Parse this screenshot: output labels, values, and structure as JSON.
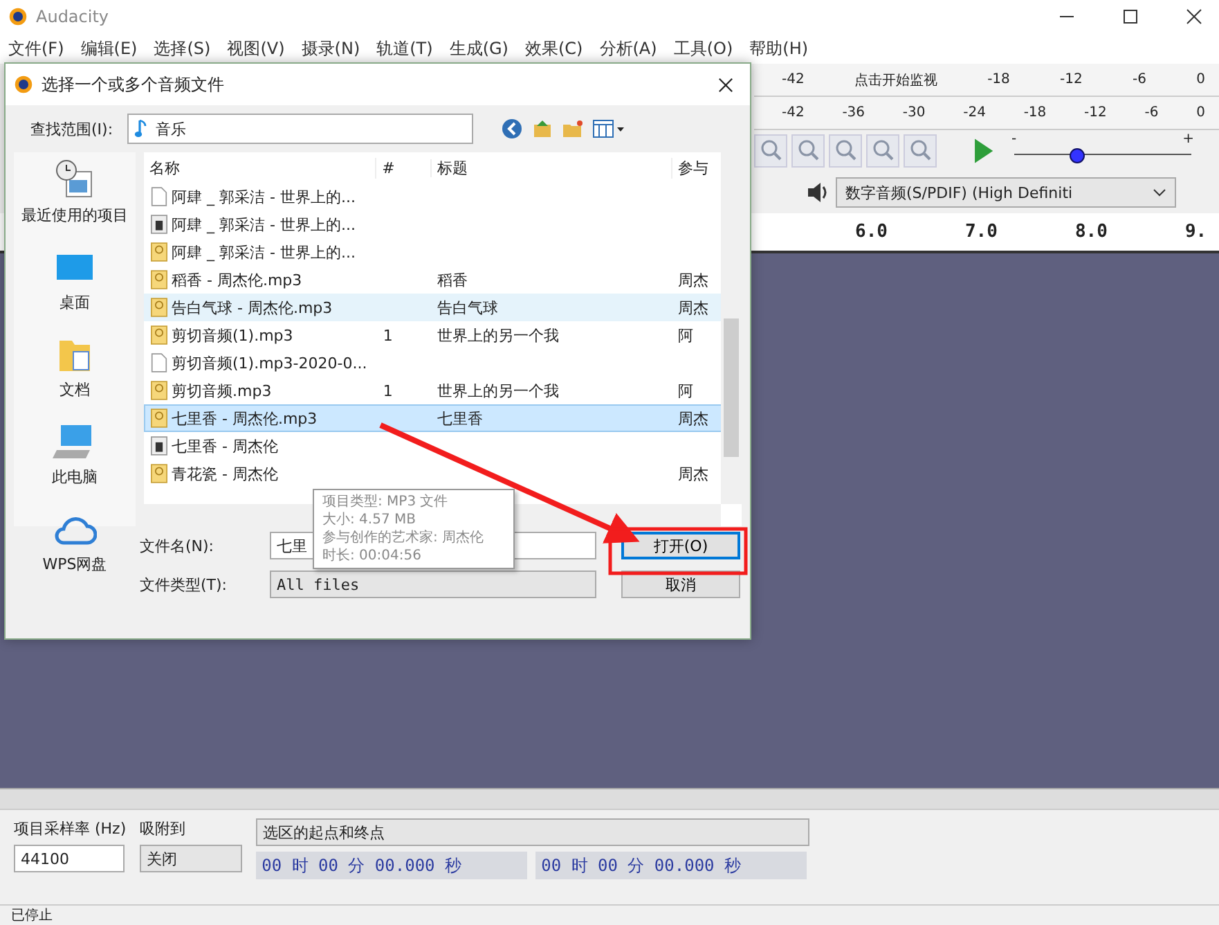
{
  "app": {
    "title": "Audacity",
    "menu": [
      "文件(F)",
      "编辑(E)",
      "选择(S)",
      "视图(V)",
      "摄录(N)",
      "轨道(T)",
      "生成(G)",
      "效果(C)",
      "分析(A)",
      "工具(O)",
      "帮助(H)"
    ]
  },
  "meters": {
    "record": [
      "-42",
      "点击开始监视",
      "-18",
      "-12",
      "-6",
      "0"
    ],
    "play": [
      "-42",
      "-36",
      "-30",
      "-24",
      "-18",
      "-12",
      "-6",
      "0"
    ]
  },
  "playback_slider": {
    "minus": "-",
    "plus": "+",
    "level": 0.34
  },
  "device": "数字音频(S/PDIF) (High Definiti",
  "ruler": [
    "6.0",
    "7.0",
    "8.0",
    "9."
  ],
  "selection_toolbar": {
    "rate_label": "项目采样率 (Hz)",
    "rate": "44100",
    "snap_label": "吸附到",
    "snap": "关闭",
    "mode": "选区的起点和终点",
    "start": "00 时 00 分 00.000 秒",
    "end": "00 时 00 分 00.000 秒"
  },
  "status": "已停止",
  "dialog": {
    "title": "选择一个或多个音频文件",
    "look_in_label": "查找范围(I):",
    "look_in": "音乐",
    "places": [
      {
        "label": "最近使用的项目",
        "kind": "recent"
      },
      {
        "label": "桌面",
        "kind": "desktop"
      },
      {
        "label": "文档",
        "kind": "documents"
      },
      {
        "label": "此电脑",
        "kind": "computer"
      },
      {
        "label": "WPS网盘",
        "kind": "cloud"
      }
    ],
    "columns": [
      "名称",
      "#",
      "标题",
      "参与"
    ],
    "rows": [
      {
        "name": "阿肆 _ 郭采洁 - 世界上的...",
        "number": "",
        "title": "",
        "artist": "",
        "kind": "blank",
        "selected": false,
        "hovered": false
      },
      {
        "name": "阿肆 _ 郭采洁 - 世界上的...",
        "number": "",
        "title": "",
        "artist": "",
        "kind": "audio",
        "selected": false,
        "hovered": false
      },
      {
        "name": "阿肆 _ 郭采洁 - 世界上的...",
        "number": "",
        "title": "",
        "artist": "",
        "kind": "music",
        "selected": false,
        "hovered": false
      },
      {
        "name": "稻香 - 周杰伦.mp3",
        "number": "",
        "title": "稻香",
        "artist": "周杰",
        "kind": "music",
        "selected": false,
        "hovered": false
      },
      {
        "name": "告白气球 - 周杰伦.mp3",
        "number": "",
        "title": "告白气球",
        "artist": "周杰",
        "kind": "music",
        "selected": false,
        "hovered": true
      },
      {
        "name": "剪切音频(1).mp3",
        "number": "1",
        "title": "世界上的另一个我",
        "artist": "阿",
        "kind": "music",
        "selected": false,
        "hovered": false
      },
      {
        "name": "剪切音频(1).mp3-2020-0...",
        "number": "",
        "title": "",
        "artist": "",
        "kind": "blank",
        "selected": false,
        "hovered": false
      },
      {
        "name": "剪切音频.mp3",
        "number": "1",
        "title": "世界上的另一个我",
        "artist": "阿",
        "kind": "music",
        "selected": false,
        "hovered": false
      },
      {
        "name": "七里香 - 周杰伦.mp3",
        "number": "",
        "title": "七里香",
        "artist": "周杰",
        "kind": "music",
        "selected": true,
        "hovered": false
      },
      {
        "name": "七里香 - 周杰伦",
        "number": "",
        "title": "",
        "artist": "",
        "kind": "audio",
        "selected": false,
        "hovered": false
      },
      {
        "name": "青花瓷 - 周杰伦",
        "number": "",
        "title": "",
        "artist": "周杰",
        "kind": "music",
        "selected": false,
        "hovered": false
      }
    ],
    "tooltip": [
      "项目类型: MP3 文件",
      "大小: 4.57 MB",
      "参与创作的艺术家: 周杰伦",
      "时长: 00:04:56"
    ],
    "file_name_label": "文件名(N):",
    "file_name": "七里",
    "file_type_label": "文件类型(T):",
    "file_type": "All files",
    "buttons": [
      "打开(O)",
      "取消"
    ]
  }
}
